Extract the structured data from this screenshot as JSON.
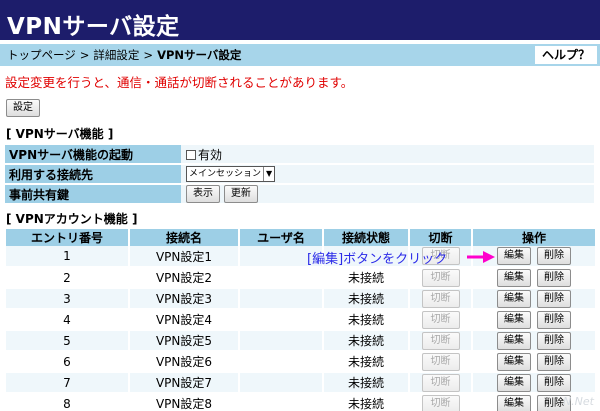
{
  "page": {
    "title": "VPNサーバ設定",
    "help": "ヘルプ？"
  },
  "breadcrumb": {
    "items": [
      "トップページ",
      "詳細設定",
      "VPNサーバ設定"
    ],
    "separator": ">"
  },
  "warning": "設定変更を行うと、通信・通話が切断されることがあります。",
  "settings_button": "設定",
  "server_section": {
    "title": "[ VPNサーバ機能 ]",
    "rows": {
      "enable": {
        "label": "VPNサーバ機能の起動",
        "checkbox_label": "有効",
        "checked": false
      },
      "connection": {
        "label": "利用する接続先",
        "selected": "メインセッション"
      },
      "psk": {
        "label": "事前共有鍵",
        "show": "表示",
        "update": "更新"
      }
    }
  },
  "account_section": {
    "title": "[ VPNアカウント機能 ]",
    "headers": [
      "エントリ番号",
      "接続名",
      "ユーザ名",
      "接続状態",
      "切断",
      "操作"
    ],
    "cut_label": "切断",
    "edit_label": "編集",
    "delete_label": "削除",
    "rows": [
      {
        "entry": "1",
        "name": "VPN設定1",
        "user": "",
        "status": ""
      },
      {
        "entry": "2",
        "name": "VPN設定2",
        "user": "",
        "status": "未接続"
      },
      {
        "entry": "3",
        "name": "VPN設定3",
        "user": "",
        "status": "未接続"
      },
      {
        "entry": "4",
        "name": "VPN設定4",
        "user": "",
        "status": "未接続"
      },
      {
        "entry": "5",
        "name": "VPN設定5",
        "user": "",
        "status": "未接続"
      },
      {
        "entry": "6",
        "name": "VPN設定6",
        "user": "",
        "status": "未接続"
      },
      {
        "entry": "7",
        "name": "VPN設定7",
        "user": "",
        "status": "未接続"
      },
      {
        "entry": "8",
        "name": "VPN設定8",
        "user": "",
        "status": "未接続"
      }
    ]
  },
  "annotation": "[編集]ボタンをクリック",
  "watermark": "N.Net",
  "colors": {
    "header": "#1d1d6b",
    "breadcrumb": "#a7d5ea",
    "warning": "#e00000",
    "annotation": "#2a2ae8",
    "arrow": "#ff00cc"
  }
}
